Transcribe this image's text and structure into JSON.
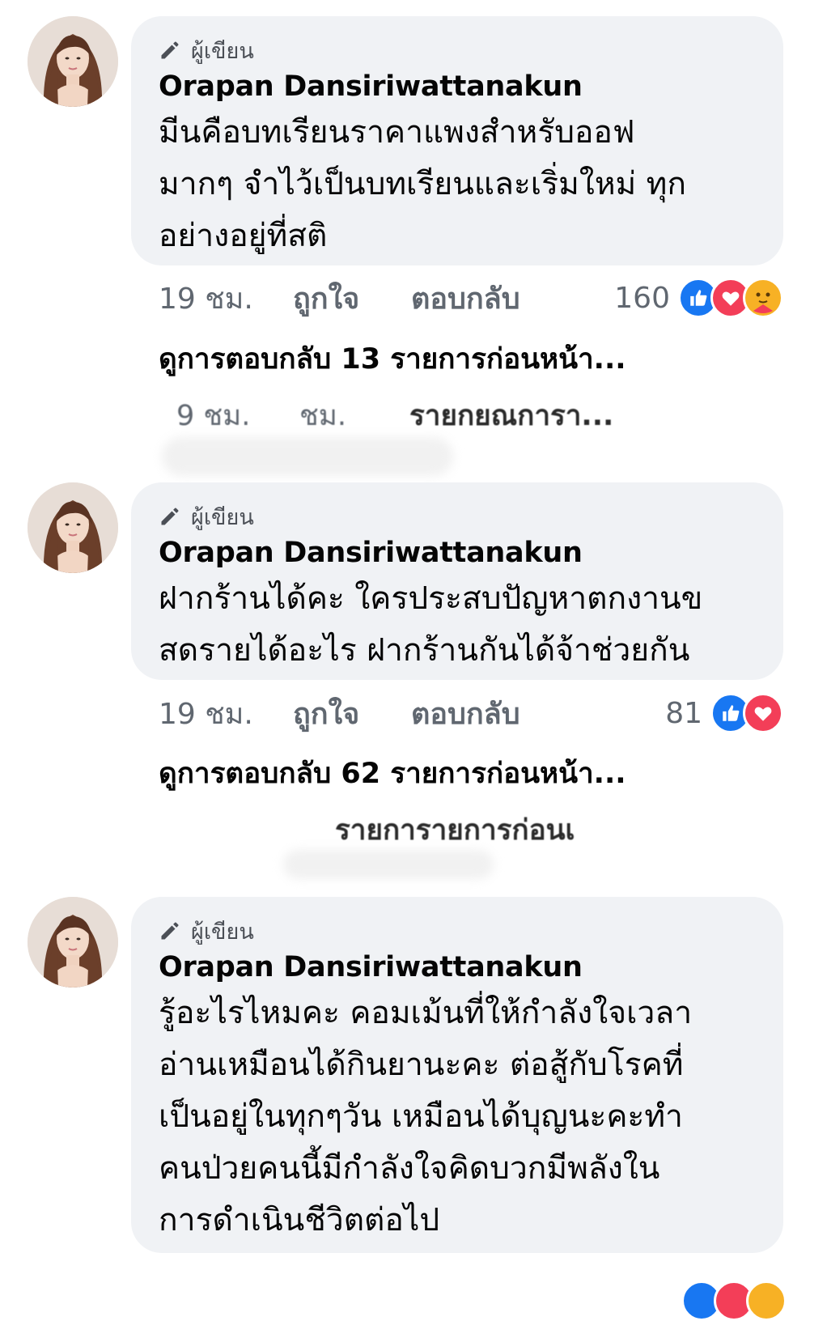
{
  "comments": [
    {
      "author_tag": "ผู้เขียน",
      "name": "Orapan Dansiriwattanakun",
      "text": "มีนคือบทเรียนราคาแพงสำหรับออฟ\nมากๆ จำไว้เป็นบทเรียนและเริ่มใหม่ ทุก\nอย่างอยู่ที่สติ",
      "time": "19 ชม.",
      "like_label": "ถูกใจ",
      "reply_label": "ตอบกลับ",
      "reaction_count": "160",
      "reactions": [
        "like-icon",
        "love-icon",
        "care-icon"
      ],
      "view_replies": "ดูการตอบกลับ 13 รายการก่อนหน้า...",
      "ghost_row": {
        "time": "9 ชม.",
        "mid": "ชม.",
        "text": "รายกยณการา..."
      }
    },
    {
      "author_tag": "ผู้เขียน",
      "name": "Orapan Dansiriwattanakun",
      "text": "ฝากร้านได้คะ ใครประสบปัญหาตกงานข\nสดรายได้อะไร ฝากร้านกันได้จ้าช่วยกัน",
      "time": "19 ชม.",
      "like_label": "ถูกใจ",
      "reply_label": "ตอบกลับ",
      "reaction_count": "81",
      "reactions": [
        "like-icon",
        "love-icon"
      ],
      "view_replies": "ดูการตอบกลับ 62 รายการก่อนหน้า...",
      "ghost_row": {
        "text": "รายการายการก่อนเ"
      }
    },
    {
      "author_tag": "ผู้เขียน",
      "name": "Orapan Dansiriwattanakun",
      "text": "รู้อะไรไหมคะ คอมเม้นที่ให้กำลังใจเวลา\nอ่านเหมือนได้กินยานะคะ ต่อสู้กับโรคที่\nเป็นอยู่ในทุกๆวัน เหมือนได้บุญนะคะทำ\nคนป่วยคนนี้มีกำลังใจคิดบวกมีพลังใน\nการดำเนินชีวิตต่อไป"
    }
  ],
  "colors": {
    "bubble": "#f0f2f5",
    "like": "#1877f2",
    "love": "#f33e58",
    "care": "#f7b125",
    "meta": "#606770"
  }
}
